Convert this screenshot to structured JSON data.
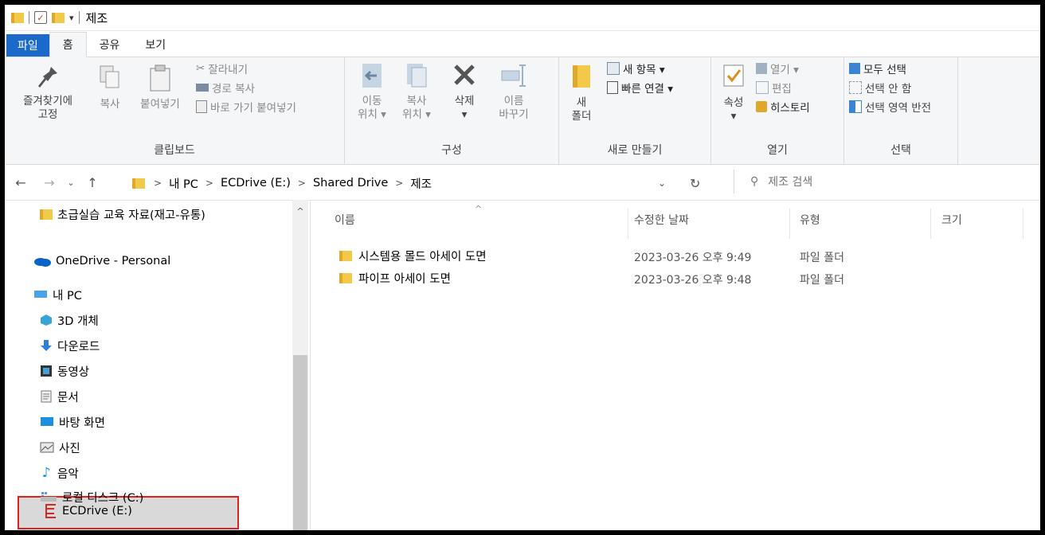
{
  "window": {
    "title": "제조"
  },
  "ribbon_tabs": {
    "file": "파일",
    "home": "홈",
    "share": "공유",
    "view": "보기"
  },
  "clipboard": {
    "pin": "즐겨찾기에 고정",
    "copy": "복사",
    "paste": "붙여넣기",
    "cut": "잘라내기",
    "copy_path": "경로 복사",
    "paste_shortcut": "바로 가기 붙여넣기",
    "label": "클립보드"
  },
  "organize": {
    "move_to_1": "이동",
    "move_to_2": "위치 ▾",
    "copy_to_1": "복사",
    "copy_to_2": "위치 ▾",
    "delete": "삭제",
    "delete_arrow": "▾",
    "rename_1": "이름",
    "rename_2": "바꾸기",
    "label": "구성"
  },
  "new_group": {
    "new_folder_1": "새",
    "new_folder_2": "폴더",
    "new_item": "새 항목 ▾",
    "easy_access": "빠른 연결 ▾",
    "label": "새로 만들기"
  },
  "open_group": {
    "properties": "속성",
    "properties_arrow": "▾",
    "open": "열기 ▾",
    "edit": "편집",
    "history": "히스토리",
    "label": "열기"
  },
  "select_group": {
    "select_all": "모두 선택",
    "select_none": "선택 안 함",
    "invert": "선택 영역 반전",
    "label": "선택"
  },
  "address": {
    "crumbs": [
      "내 PC",
      "ECDrive (E:)",
      "Shared Drive",
      "제조"
    ]
  },
  "search": {
    "placeholder": "제조 검색"
  },
  "nav_pane": {
    "items": [
      "초급실습 교육 자료(재고-유통)",
      "OneDrive - Personal",
      "내 PC",
      "3D 개체",
      "다운로드",
      "동영상",
      "문서",
      "바탕 화면",
      "사진",
      "음악",
      "로컬 디스크 (C:)",
      "ECDrive (E:)"
    ]
  },
  "columns": {
    "name": "이름",
    "modified": "수정한 날짜",
    "type": "유형",
    "size": "크기"
  },
  "files": [
    {
      "name": "시스템용 몰드 아세이 도면",
      "modified": "2023-03-26 오후 9:49",
      "type": "파일 폴더"
    },
    {
      "name": "파이프 아세이 도면",
      "modified": "2023-03-26 오후 9:48",
      "type": "파일 폴더"
    }
  ]
}
